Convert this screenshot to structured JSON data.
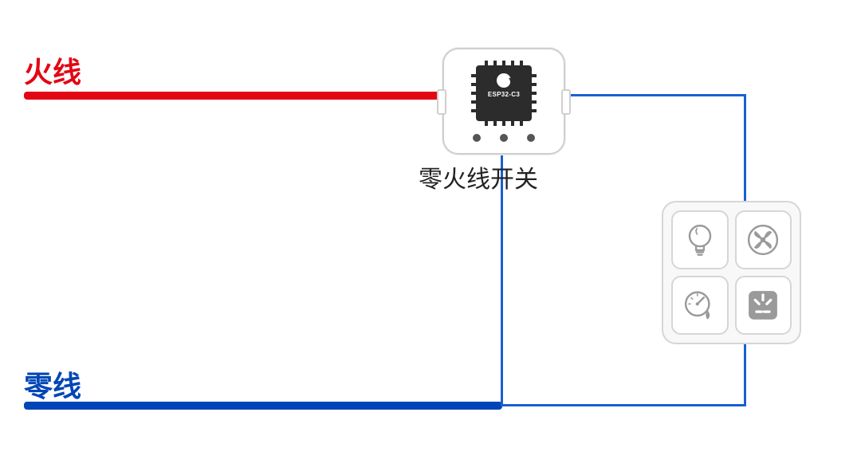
{
  "labels": {
    "live": "火线",
    "neutral": "零线",
    "switch": "零火线开关",
    "chip": "ESP32-C3"
  },
  "wires": {
    "live_color": "#e30613",
    "neutral_color": "#0046b6",
    "signal_color": "#1960d2"
  },
  "loads": [
    "light-bulb",
    "fan",
    "gauge-humidity",
    "power-socket"
  ]
}
